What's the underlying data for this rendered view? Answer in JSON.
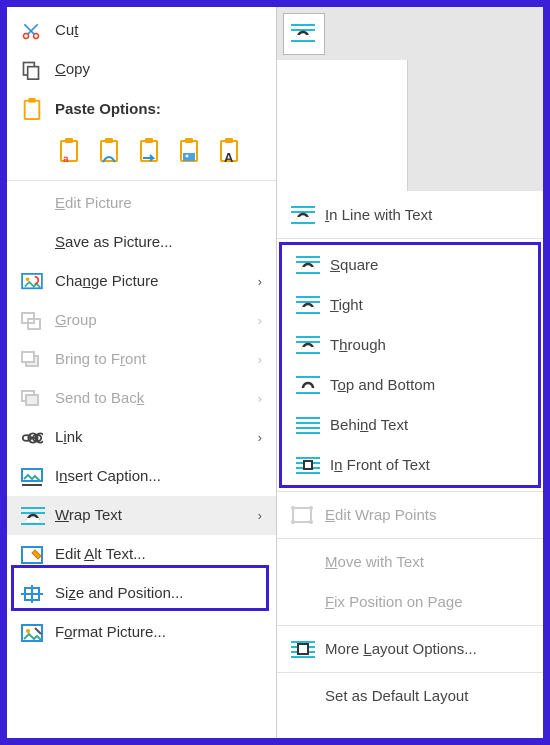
{
  "ribbon": {
    "button_name": "wrap-text"
  },
  "context_menu": {
    "cut": "Cut",
    "copy": "Copy",
    "paste_header": "Paste Options:",
    "paste_options": [
      "keep-source",
      "merge",
      "picture-only",
      "picture",
      "text-only"
    ],
    "edit_picture": "Edit Picture",
    "save_as_picture": "Save as Picture...",
    "change_picture": "Change Picture",
    "group": "Group",
    "bring_to_front": "Bring to Front",
    "send_to_back": "Send to Back",
    "link": "Link",
    "insert_caption": "Insert Caption...",
    "wrap_text": "Wrap Text",
    "edit_alt_text": "Edit Alt Text...",
    "size_and_position": "Size and Position...",
    "format_picture": "Format Picture..."
  },
  "wrap_submenu": {
    "in_line": "In Line with Text",
    "square": "Square",
    "tight": "Tight",
    "through": "Through",
    "top_bottom": "Top and Bottom",
    "behind": "Behind Text",
    "in_front": "In Front of Text",
    "edit_wrap_points": "Edit Wrap Points",
    "move_with_text": "Move with Text",
    "fix_position": "Fix Position on Page",
    "more_layout": "More Layout Options...",
    "set_default": "Set as Default Layout"
  }
}
